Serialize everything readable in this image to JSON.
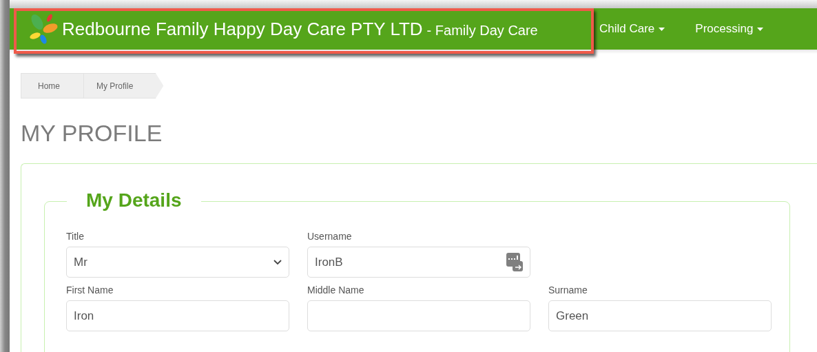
{
  "navbar": {
    "brand": "Redbourne Family Happy Day Care PTY LTD",
    "brand_suffix": "- Family Day Care",
    "menus": [
      {
        "label": "Child Care"
      },
      {
        "label": "Processing"
      }
    ]
  },
  "breadcrumb": [
    {
      "label": "Home"
    },
    {
      "label": "My Profile"
    }
  ],
  "page_title": "MY PROFILE",
  "section": {
    "legend": "My Details",
    "rows": [
      [
        {
          "label": "Title",
          "value": "Mr",
          "kind": "select"
        },
        {
          "label": "Username",
          "value": "IronB",
          "kind": "text_icon"
        }
      ],
      [
        {
          "label": "First Name",
          "value": "Iron",
          "kind": "text"
        },
        {
          "label": "Middle Name",
          "kind": "text"
        },
        {
          "label": "Surname",
          "value": "Green",
          "kind": "text"
        }
      ]
    ]
  }
}
